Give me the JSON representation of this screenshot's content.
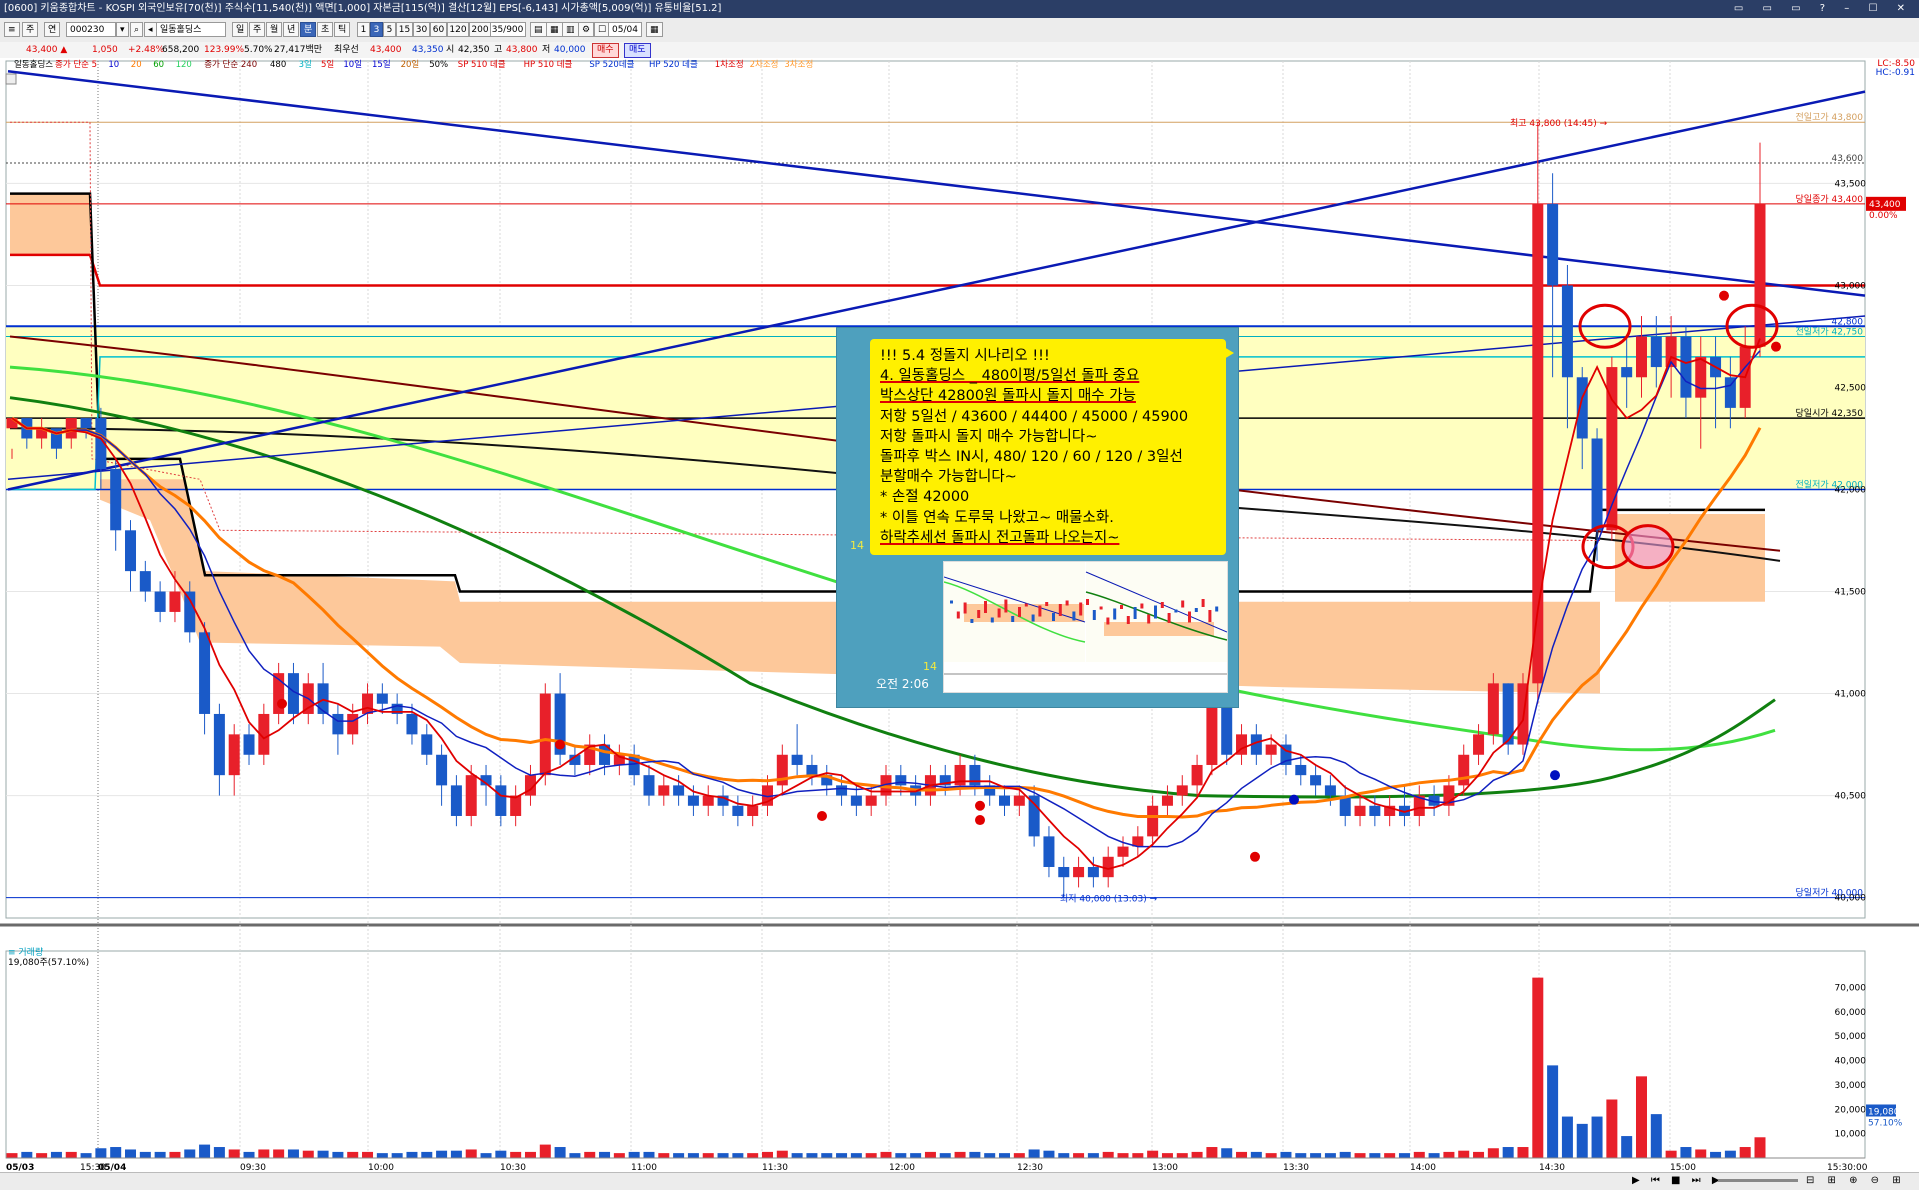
{
  "window": {
    "title": "[0600] 키움종합차트 - KOSPI 외국인보유[70(천)] 주식수[11,540(천)] 액면[1,000] 자본금[115(억)] 결산[12월] EPS[-6,143] 시가총액[5,009(억)] 유통비율[51.2]"
  },
  "toolbar": {
    "code": "000230",
    "stock_name": "일동홀딩스",
    "period_buttons": [
      "일",
      "주",
      "월",
      "년",
      "분",
      "초",
      "틱"
    ],
    "selected_period": "분",
    "interval_buttons": [
      "1",
      "3",
      "5",
      "15",
      "30",
      "60",
      "120",
      "200"
    ],
    "selected_interval": "3",
    "interval_value": "3",
    "count": "135/900",
    "date": "05/04",
    "label_main": "주",
    "label_join": "연"
  },
  "quote": {
    "price": "43,400 ▲",
    "change": "1,050",
    "rate": "+2.48%",
    "volume": "658,200",
    "vol_rate": "123.99%",
    "turnover": "5.70%",
    "amount": "27,417백만",
    "order_label": "최우선",
    "ask": "43,400",
    "bid": "43,350",
    "open_label": "시",
    "open": "42,350",
    "high_label": "고",
    "high": "43,800",
    "low_label": "저",
    "low": "40,000",
    "buy_button": "매수",
    "sell_button": "매도"
  },
  "chart_data": {
    "type": "candlestick",
    "legend": [
      {
        "text": "일동홀딩스",
        "color": "#000000"
      },
      {
        "text": "종가 단순 5",
        "color": "#e00000"
      },
      {
        "text": "10",
        "color": "#0000d0"
      },
      {
        "text": "20",
        "color": "#ff7a00"
      },
      {
        "text": "60",
        "color": "#00a000"
      },
      {
        "text": "120",
        "color": "#28d060"
      },
      {
        "text": "종가 단순 240",
        "color": "#7a0000"
      },
      {
        "text": "480",
        "color": "#000000"
      },
      {
        "text": "3일",
        "color": "#00b0c0"
      },
      {
        "text": "5일",
        "color": "#e00000"
      },
      {
        "text": "10일",
        "color": "#0000d0"
      },
      {
        "text": "15일",
        "color": "#0000d0"
      },
      {
        "text": "20일",
        "color": "#c06000"
      },
      {
        "text": "50%",
        "color": "#000000"
      },
      {
        "text": "SP 510 데클",
        "color": "#e00000"
      },
      {
        "text": "HP 510 데클",
        "color": "#e00000"
      },
      {
        "text": "SP 520데클",
        "color": "#0030d0"
      },
      {
        "text": "HP 520 데클",
        "color": "#0030d0"
      },
      {
        "text": "1차조정",
        "color": "#e00000"
      },
      {
        "text": "2차조정",
        "color": "#ff9a30"
      },
      {
        "text": "3차조정",
        "color": "#ff9a30"
      }
    ],
    "price_axis": {
      "ticks": [
        "43,500",
        "43,000",
        "42,500",
        "42,000",
        "41,500",
        "41,000",
        "40,500",
        "40,000"
      ],
      "ylim": [
        39900,
        44100
      ],
      "top_labels": [
        "LC:-8.50",
        "HC:-0.91"
      ]
    },
    "time_axis": {
      "labels": [
        "05/03",
        "15:30",
        "05/04",
        "09:30",
        "10:00",
        "10:30",
        "11:00",
        "11:30",
        "12:00",
        "12:30",
        "13:00",
        "13:30",
        "14:00",
        "14:30",
        "15:00",
        "15:30:00"
      ]
    },
    "levels": [
      {
        "label": "전일고가 43,800",
        "value": 43800,
        "color": "#d4a060"
      },
      {
        "label": "43,600",
        "value": 43600,
        "color": "#444444"
      },
      {
        "label": "당일종가 43,400",
        "value": 43400,
        "color": "#e00000"
      },
      {
        "label": "42,800",
        "value": 42800,
        "color": "#0030d0"
      },
      {
        "label": "전일저가 42,750",
        "value": 42750,
        "color": "#00b0c0"
      },
      {
        "label": "당일시가 42,350",
        "value": 42350,
        "color": "#000000"
      },
      {
        "label": "전일저가 42,000",
        "value": 42000,
        "color": "#00b0c0"
      },
      {
        "label": "당일저가 40,000",
        "value": 40000,
        "color": "#0030d0"
      }
    ],
    "current_price_label": "43,400",
    "current_rate_label": "0.00%",
    "high_annotation": "최고 43,800 (14:45)",
    "low_annotation": "최저 40,000 (13:03)",
    "candles": [
      [
        42300,
        42350,
        42200,
        42150
      ],
      [
        42350,
        42250,
        42300,
        42200
      ],
      [
        42250,
        42300,
        42350,
        42200
      ],
      [
        42300,
        42200,
        42250,
        42150
      ],
      [
        42250,
        42350,
        42300,
        42200
      ],
      [
        42350,
        42300,
        42350,
        42250
      ],
      [
        42350,
        42100,
        42400,
        42000
      ],
      [
        42100,
        41800,
        42150,
        41700
      ],
      [
        41800,
        41600,
        41850,
        41500
      ],
      [
        41600,
        41500,
        41650,
        41450
      ],
      [
        41500,
        41400,
        41550,
        41350
      ],
      [
        41400,
        41500,
        41600,
        41350
      ],
      [
        41500,
        41300,
        41550,
        41250
      ],
      [
        41300,
        40900,
        41350,
        40800
      ],
      [
        40900,
        40600,
        40950,
        40500
      ],
      [
        40600,
        40800,
        40850,
        40500
      ],
      [
        40800,
        40700,
        40850,
        40650
      ],
      [
        40700,
        40900,
        40950,
        40650
      ],
      [
        40900,
        41100,
        41150,
        40850
      ],
      [
        41100,
        40900,
        41150,
        40850
      ],
      [
        40900,
        41050,
        41100,
        40850
      ],
      [
        41050,
        40900,
        41150,
        40850
      ],
      [
        40900,
        40800,
        40950,
        40700
      ],
      [
        40800,
        40900,
        40950,
        40750
      ],
      [
        40900,
        41000,
        41050,
        40850
      ],
      [
        41000,
        40950,
        41050,
        40900
      ],
      [
        40950,
        40900,
        41000,
        40850
      ],
      [
        40900,
        40800,
        40950,
        40750
      ],
      [
        40800,
        40700,
        40850,
        40650
      ],
      [
        40700,
        40550,
        40750,
        40450
      ],
      [
        40550,
        40400,
        40600,
        40350
      ],
      [
        40400,
        40600,
        40650,
        40350
      ],
      [
        40600,
        40550,
        40650,
        40450
      ],
      [
        40550,
        40400,
        40600,
        40350
      ],
      [
        40400,
        40500,
        40550,
        40350
      ],
      [
        40500,
        40600,
        40650,
        40450
      ],
      [
        40600,
        41000,
        41050,
        40550
      ],
      [
        41000,
        40700,
        41100,
        40650
      ],
      [
        40700,
        40650,
        40750,
        40600
      ],
      [
        40650,
        40750,
        40800,
        40600
      ],
      [
        40750,
        40650,
        40800,
        40600
      ],
      [
        40650,
        40700,
        40750,
        40600
      ],
      [
        40700,
        40600,
        40750,
        40550
      ],
      [
        40600,
        40500,
        40650,
        40450
      ],
      [
        40500,
        40550,
        40600,
        40450
      ],
      [
        40550,
        40500,
        40600,
        40450
      ],
      [
        40500,
        40450,
        40550,
        40400
      ],
      [
        40450,
        40500,
        40550,
        40400
      ],
      [
        40500,
        40450,
        40550,
        40400
      ],
      [
        40450,
        40400,
        40500,
        40350
      ],
      [
        40400,
        40450,
        40500,
        40350
      ],
      [
        40450,
        40550,
        40600,
        40400
      ],
      [
        40550,
        40700,
        40750,
        40500
      ],
      [
        40700,
        40650,
        40850,
        40600
      ],
      [
        40650,
        40600,
        40700,
        40550
      ],
      [
        40600,
        40550,
        40650,
        40500
      ],
      [
        40550,
        40500,
        40600,
        40450
      ],
      [
        40500,
        40450,
        40550,
        40400
      ],
      [
        40450,
        40500,
        40550,
        40400
      ],
      [
        40500,
        40600,
        40650,
        40450
      ],
      [
        40600,
        40550,
        40650,
        40500
      ],
      [
        40550,
        40500,
        40600,
        40450
      ],
      [
        40500,
        40600,
        40650,
        40450
      ],
      [
        40600,
        40550,
        40650,
        40500
      ],
      [
        40550,
        40650,
        40700,
        40500
      ],
      [
        40650,
        40550,
        40700,
        40500
      ],
      [
        40550,
        40500,
        40600,
        40450
      ],
      [
        40500,
        40450,
        40550,
        40400
      ],
      [
        40450,
        40500,
        40550,
        40400
      ],
      [
        40500,
        40300,
        40550,
        40250
      ],
      [
        40300,
        40150,
        40350,
        40100
      ],
      [
        40150,
        40100,
        40200,
        40000
      ],
      [
        40100,
        40150,
        40200,
        40050
      ],
      [
        40150,
        40100,
        40200,
        40050
      ],
      [
        40100,
        40200,
        40250,
        40050
      ],
      [
        40200,
        40250,
        40300,
        40150
      ],
      [
        40250,
        40300,
        40350,
        40200
      ],
      [
        40300,
        40450,
        40500,
        40250
      ],
      [
        40450,
        40500,
        40550,
        40400
      ],
      [
        40500,
        40550,
        40600,
        40450
      ],
      [
        40550,
        40650,
        40700,
        40500
      ],
      [
        40650,
        40950,
        41000,
        40600
      ],
      [
        40950,
        40700,
        40950,
        40650
      ],
      [
        40700,
        40800,
        40850,
        40650
      ],
      [
        40800,
        40700,
        40850,
        40650
      ],
      [
        40700,
        40750,
        40800,
        40650
      ],
      [
        40750,
        40650,
        40800,
        40600
      ],
      [
        40650,
        40600,
        40700,
        40550
      ],
      [
        40600,
        40550,
        40650,
        40500
      ],
      [
        40550,
        40500,
        40600,
        40450
      ],
      [
        40500,
        40400,
        40550,
        40350
      ],
      [
        40400,
        40450,
        40500,
        40350
      ],
      [
        40450,
        40400,
        40500,
        40350
      ],
      [
        40400,
        40450,
        40500,
        40350
      ],
      [
        40450,
        40400,
        40550,
        40350
      ],
      [
        40400,
        40500,
        40550,
        40350
      ],
      [
        40500,
        40450,
        40550,
        40400
      ],
      [
        40450,
        40550,
        40600,
        40400
      ],
      [
        40550,
        40700,
        40750,
        40500
      ],
      [
        40700,
        40800,
        40850,
        40650
      ],
      [
        40800,
        41050,
        41100,
        40750
      ],
      [
        41050,
        40750,
        41050,
        40700
      ],
      [
        40750,
        41050,
        41100,
        40700
      ],
      [
        41050,
        43400,
        43800,
        40950
      ],
      [
        43400,
        43000,
        43550,
        42550
      ],
      [
        43000,
        42550,
        43100,
        42300
      ],
      [
        42550,
        42250,
        42600,
        42100
      ],
      [
        42250,
        41800,
        42300,
        41650
      ],
      [
        41800,
        42600,
        42650,
        41750
      ],
      [
        42600,
        42550,
        42750,
        42400
      ],
      [
        42550,
        42750,
        42850,
        42450
      ],
      [
        42750,
        42600,
        42850,
        42500
      ],
      [
        42600,
        42750,
        42850,
        42450
      ],
      [
        42750,
        42450,
        42800,
        42350
      ],
      [
        42450,
        42650,
        42750,
        42200
      ],
      [
        42650,
        42550,
        42750,
        42300
      ],
      [
        42550,
        42400,
        42650,
        42300
      ],
      [
        42400,
        42700,
        42800,
        42350
      ],
      [
        42700,
        43400,
        43700,
        42650
      ]
    ],
    "volume_axis": {
      "ticks": [
        "70,000",
        "60,000",
        "50,000",
        "40,000",
        "30,000",
        "20,000",
        "10,000"
      ],
      "ymax": 80000
    },
    "volume_title": "거래량",
    "volume_label": "19,080주(57.10%)",
    "volume_current_label": "19,080",
    "volume_current_rate": "57.10%"
  },
  "memo": {
    "lines": [
      "!!! 5.4 정돌지 시나리오 !!!",
      "4. 일동홀딩스 _ 480이평/5일선 돌파 중요",
      "박스상단 42800원 돌파시 돌지 매수 가능",
      "저항 5일선 / 43600 / 44400 / 45000 / 45900",
      "저항 돌파시 돌지 매수 가능합니다~",
      "돌파후 박스 IN시, 480/ 120 / 60 / 120 / 3일선",
      "분할매수 가능합니다~",
      "* 손절 42000",
      "* 이틀 연속 도루묵 나왔고~ 매물소화.",
      "하락추세선 돌파시 전고돌파 나오는지~"
    ],
    "read_count_1": "14",
    "read_count_2": "14",
    "time": "오전 2:06"
  },
  "statusbar": {
    "nav": "▶ ⏮ ■ ⏭ ▶",
    "icons": "⊟ ⊞ ⊕ ⊖ ⊞"
  }
}
